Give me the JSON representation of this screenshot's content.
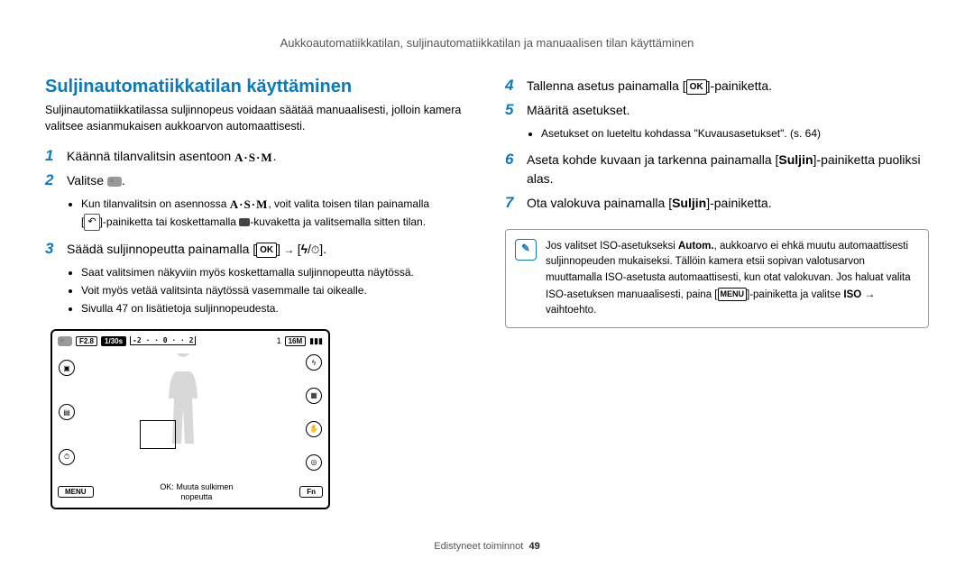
{
  "header": "Aukkoautomatiikkatilan, suljinautomatiikkatilan ja manuaalisen tilan käyttäminen",
  "left": {
    "title": "Suljinautomatiikkatilan käyttäminen",
    "intro": "Suljinautomatiikkatilassa suljinnopeus voidaan säätää manuaalisesti, jolloin kamera valitsee asianmukaisen aukkoarvon automaattisesti.",
    "step1_num": "1",
    "step1_text": "Käännä tilanvalitsin asentoon ",
    "asm": "A·S·M",
    "step2_num": "2",
    "step2_text": "Valitse ",
    "step2_after": ".",
    "bullet2a_pre": "Kun tilanvalitsin on asennossa ",
    "bullet2a_post": ", voit valita toisen tilan painamalla",
    "bullet2b_pre": "[",
    "bullet2b_mid": "]-painiketta tai koskettamalla ",
    "bullet2b_post": "-kuvaketta ja valitsemalla sitten tilan.",
    "step3_num": "3",
    "step3_text": "Säädä suljinnopeutta painamalla [",
    "step3_arrow": " → ",
    "step3_after": "[",
    "step3_end": "].",
    "bullet3a": "Saat valitsimen näkyviin myös koskettamalla suljinnopeutta näytössä.",
    "bullet3b": "Voit myös vetää valitsinta näytössä vasemmalle tai oikealle.",
    "bullet3c": "Sivulla 47 on lisätietoja suljinnopeudesta."
  },
  "lcd": {
    "f": "F2.8",
    "shutter": "1/30s",
    "count": "1",
    "size": "16M",
    "menu": "MENU",
    "fn": "Fn",
    "bottom1": "OK: Muuta sulkimen",
    "bottom2": "nopeutta",
    "scale": "-2 · · 0 · · 2"
  },
  "right": {
    "step4_num": "4",
    "step4_text": "Tallenna asetus painamalla [",
    "step4_after": "]-painiketta.",
    "step5_num": "5",
    "step5_text": "Määritä asetukset.",
    "bullet5": "Asetukset on lueteltu kohdassa \"Kuvausasetukset\". (s. 64)",
    "step6_num": "6",
    "step6_pre": "Aseta kohde kuvaan ja tarkenna painamalla [",
    "step6_bold": "Suljin",
    "step6_post": "]-painiketta puoliksi alas.",
    "step7_num": "7",
    "step7_pre": "Ota valokuva painamalla [",
    "step7_bold": "Suljin",
    "step7_post": "]-painiketta.",
    "note_pre": "Jos valitset ISO-asetukseksi ",
    "note_autom": "Autom.",
    "note_mid": ", aukkoarvo ei ehkä muutu automaattisesti suljinnopeuden mukaiseksi. Tällöin kamera etsii sopivan valotusarvon muuttamalla ISO-asetusta automaattisesti, kun otat valokuvan. Jos haluat valita ISO-asetuksen manuaalisesti, paina [",
    "note_post": "]-painiketta ja valitse ",
    "note_iso": "ISO",
    "note_arrow": " → ",
    "note_end": "vaihtoehto."
  },
  "footer": {
    "label": "Edistyneet toiminnot",
    "page": "49"
  }
}
